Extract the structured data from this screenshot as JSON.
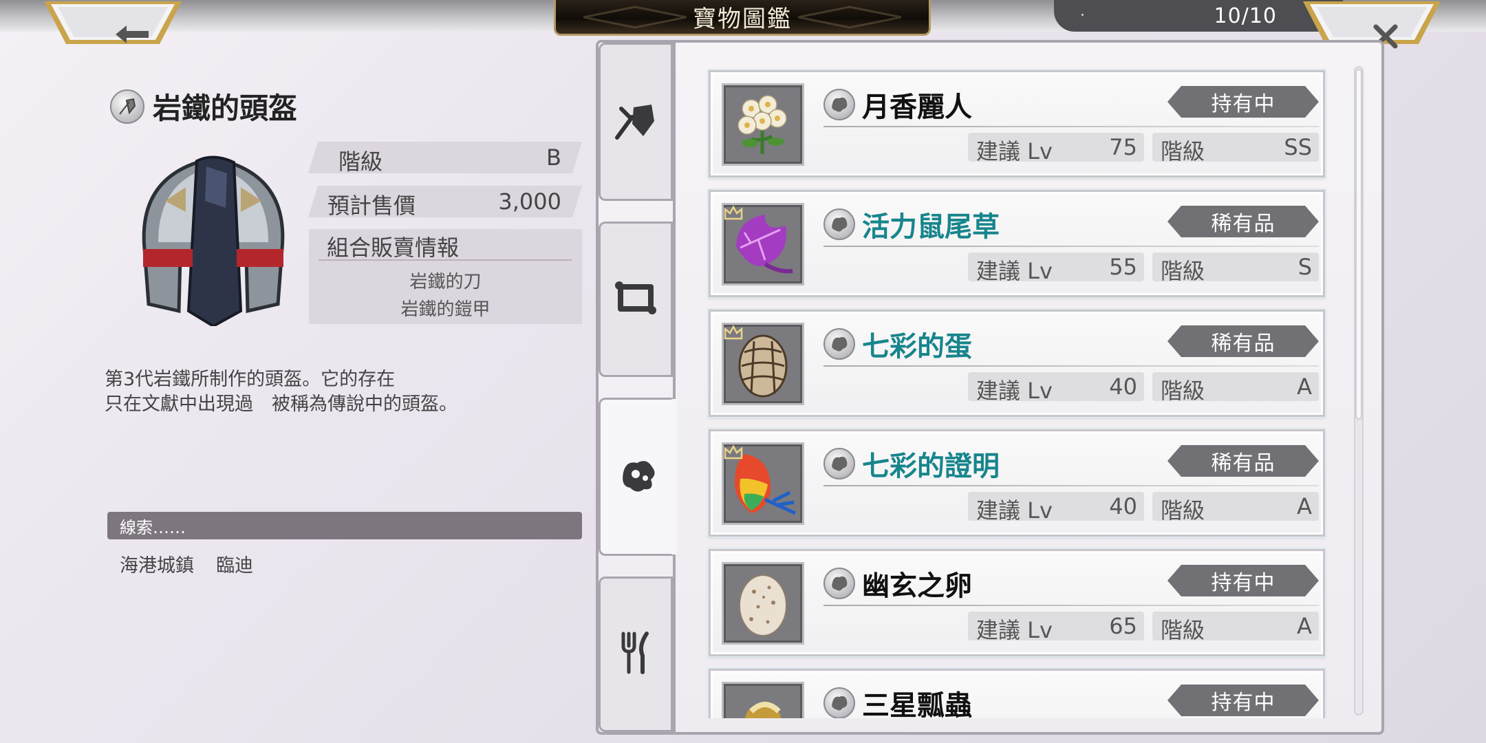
{
  "header": {
    "title": "寶物圖鑑",
    "counter": "10/10",
    "back_icon": "arrow-left-icon",
    "close_icon": "close-x-icon"
  },
  "detail": {
    "category_icon": "armor-icon",
    "name": "岩鐵的頭盔",
    "rank_label": "階級",
    "rank_value": "B",
    "price_label": "預計售價",
    "price_value": "3,000",
    "combo_title": "組合販賣情報",
    "combo_items": [
      "岩鐵的刀",
      "岩鐵的鎧甲"
    ],
    "description_lines": [
      "第3代岩鐵所制作的頭盔。它的存在",
      "只在文獻中出現過　被稱為傳說中的頭盔。"
    ],
    "clue_label": "線索……",
    "clue_locations": [
      "海港城鎮",
      "臨迪"
    ]
  },
  "tabs": [
    {
      "icon": "weapon-armor-icon",
      "active": false
    },
    {
      "icon": "scroll-icon",
      "active": false
    },
    {
      "icon": "material-icon",
      "active": true
    },
    {
      "icon": "fork-knife-icon",
      "active": false
    }
  ],
  "list": {
    "lv_label": "建議 Lv",
    "rank_label": "階級",
    "items": [
      {
        "name": "月香麗人",
        "status": "持有中",
        "lv": "75",
        "rank": "SS",
        "rare": false,
        "crown": false,
        "thumb": "flower-icon"
      },
      {
        "name": "活力鼠尾草",
        "status": "稀有品",
        "lv": "55",
        "rank": "S",
        "rare": true,
        "crown": true,
        "thumb": "purple-leaf-icon"
      },
      {
        "name": "七彩的蛋",
        "status": "稀有品",
        "lv": "40",
        "rank": "A",
        "rare": true,
        "crown": true,
        "thumb": "scaled-egg-icon"
      },
      {
        "name": "七彩的證明",
        "status": "稀有品",
        "lv": "40",
        "rank": "A",
        "rare": true,
        "crown": true,
        "thumb": "rainbow-feather-icon"
      },
      {
        "name": "幽玄之卵",
        "status": "持有中",
        "lv": "65",
        "rank": "A",
        "rare": false,
        "crown": false,
        "thumb": "speckled-egg-icon"
      },
      {
        "name": "三星瓢蟲",
        "status": "持有中",
        "lv": "",
        "rank": "",
        "rare": false,
        "crown": false,
        "thumb": "ladybug-icon"
      }
    ]
  },
  "colors": {
    "rare_name": "#17858c",
    "tag_bg": "#707075",
    "stat_bg": "#dcd6de"
  }
}
